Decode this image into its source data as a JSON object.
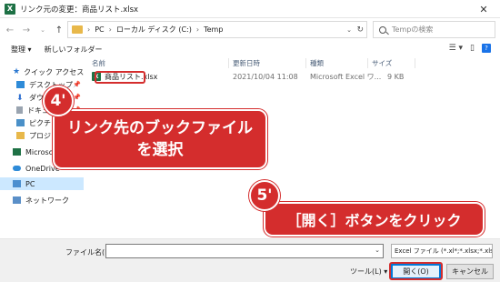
{
  "window": {
    "title": "リンク元の変更：商品リスト.xlsx",
    "app_icon": "X",
    "close_glyph": "✕"
  },
  "address": {
    "crumbs": [
      "PC",
      "ローカル ディスク (C:)",
      "Temp"
    ],
    "separator": "›",
    "search_placeholder": "Tempの検索"
  },
  "commands": {
    "organize": "整理 ▾",
    "new_folder": "新しいフォルダー",
    "help": "?"
  },
  "nav": {
    "items": [
      {
        "label": "クイック アクセス",
        "pinned": false
      },
      {
        "label": "デスクトップ",
        "pinned": true
      },
      {
        "label": "ダウンロード",
        "pinned": true
      },
      {
        "label": "ドキュメント",
        "pinned": true
      },
      {
        "label": "ピクチャ",
        "pinned": true
      },
      {
        "label": "プロジェクト",
        "pinned": false
      },
      {
        "label": "Microsoft Excel",
        "pinned": false
      },
      {
        "label": "OneDrive",
        "pinned": false
      },
      {
        "label": "PC",
        "pinned": false
      },
      {
        "label": "ネットワーク",
        "pinned": false
      }
    ]
  },
  "columns": {
    "name": "名前",
    "date": "更新日時",
    "type": "種類",
    "size": "サイズ"
  },
  "files": [
    {
      "name": "商品リスト.xlsx",
      "date": "2021/10/04 11:08",
      "type": "Microsoft Excel ワ...",
      "size": "9 KB"
    }
  ],
  "bottom": {
    "filename_label": "ファイル名(N):",
    "filename_value": "",
    "filter": "Excel ファイル (*.xl*;*.xlsx;*.xlsm;*",
    "tools": "ツール(L) ▾",
    "open": "開く(O)",
    "cancel": "キャンセル"
  },
  "callouts": {
    "step4_badge": "4'",
    "step4_text": "リンク先のブックファイルを選択",
    "step5_badge": "5'",
    "step5_text": "［開く］ボタンをクリック"
  },
  "colors": {
    "accent": "#d42d2d",
    "selection": "#cce8ff",
    "primary_button_border": "#0078d7",
    "excel_green": "#1e7145"
  }
}
